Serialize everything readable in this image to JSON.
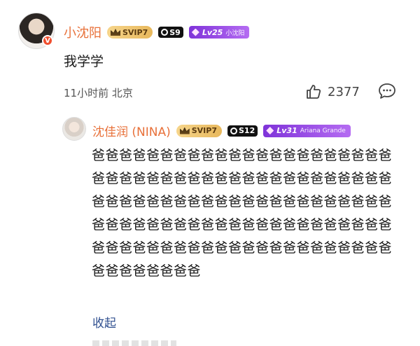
{
  "comment": {
    "author": "小沈阳",
    "verified_badge": "V",
    "svip_badge": "SVIP7",
    "s_badge": "S9",
    "level": "Lv25",
    "level_title": "小沈阳",
    "text": "我学学",
    "meta": "11小时前 北京",
    "likes": "2377",
    "icons": [
      "thumb-up-icon",
      "comment-bubble-icon"
    ]
  },
  "reply": {
    "author": "沈佳润 (NINA)",
    "svip_badge": "SVIP7",
    "s_badge": "S12",
    "level": "Lv31",
    "level_title": "Ariana Grande",
    "text": "爸爸爸爸爸爸爸爸爸爸爸爸爸爸爸爸爸爸爸爸爸爸爸爸爸爸爸爸爸爸爸爸爸爸爸爸爸爸爸爸爸爸爸爸爸爸爸爸爸爸爸爸爸爸爸爸爸爸爸爸爸爸爸爸爸爸爸爸爸爸爸爸爸爸爸爸爸爸爸爸爸爸爸爸爸爸爸爸爸爸爸爸爸爸爸爸爸爸爸爸爸爸爸爸爸爸爸爸爸爸爸爸爸爸爸爸爸爸",
    "collapse_label": "收起"
  },
  "colors": {
    "name": "#e8713a",
    "svip": "#e8b85c",
    "level": "#9b4de6",
    "verified": "#f04e2e",
    "link": "#2f4f8f"
  }
}
